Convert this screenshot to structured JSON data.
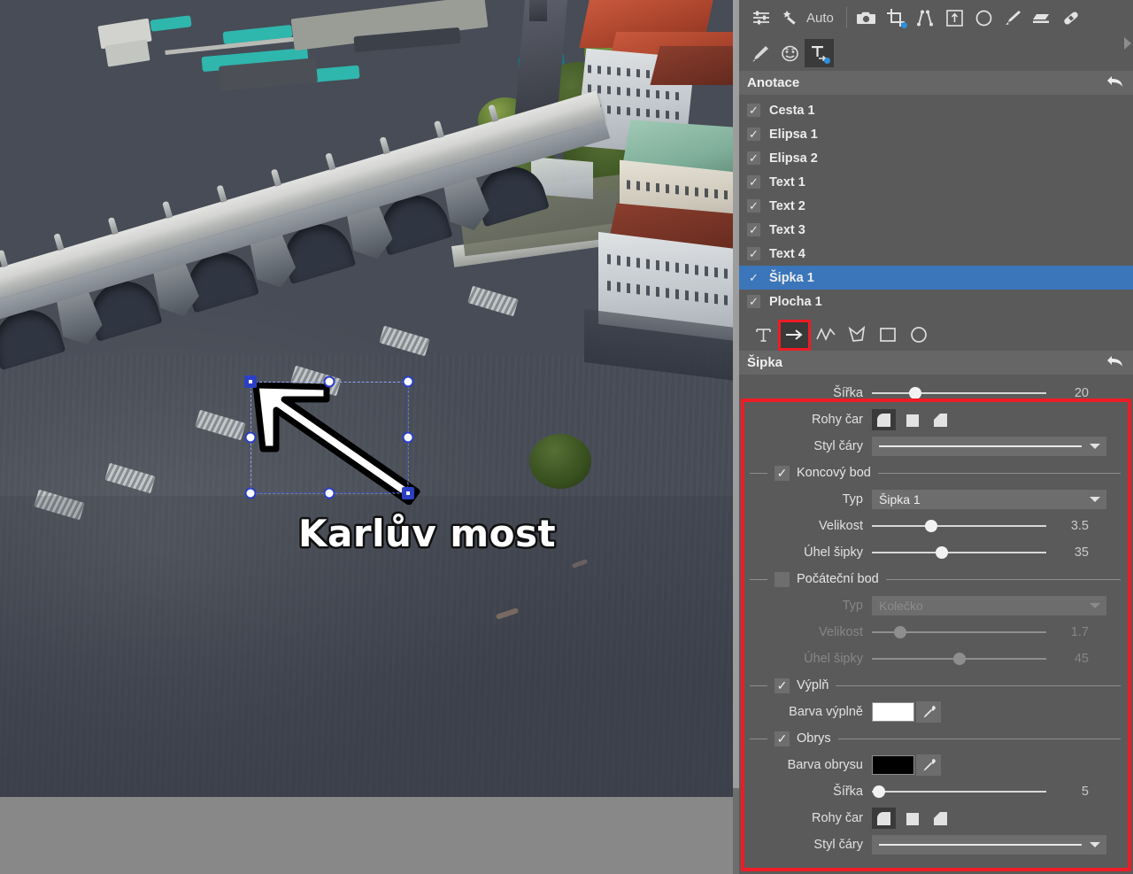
{
  "app": {
    "canvas": {
      "label_text": "Karlův most",
      "scene": "aerial-view-charles-bridge-prague"
    },
    "toolbar": {
      "row1": [
        {
          "name": "adjustments-sliders-icon",
          "label": "",
          "selected": false
        },
        {
          "name": "magic-wand-icon",
          "label": "",
          "selected": false
        },
        {
          "name": "auto-label",
          "label": "Auto",
          "selected": false
        },
        {
          "name": "camera-icon",
          "label": "",
          "selected": false
        },
        {
          "name": "crop-icon",
          "label": "",
          "selected": false,
          "dot": true
        },
        {
          "name": "perspective-icon",
          "label": "",
          "selected": false
        },
        {
          "name": "rotate-frame-icon",
          "label": "",
          "selected": false
        },
        {
          "name": "ellipse-icon",
          "label": "",
          "selected": false
        },
        {
          "name": "brush-icon",
          "label": "",
          "selected": false
        },
        {
          "name": "gradient-icon",
          "label": "",
          "selected": false
        },
        {
          "name": "healing-patch-icon",
          "label": "",
          "selected": false
        }
      ],
      "row2": [
        {
          "name": "clone-stamp-icon",
          "label": "",
          "selected": false
        },
        {
          "name": "face-mask-icon",
          "label": "",
          "selected": false
        },
        {
          "name": "text-annotation-icon",
          "label": "",
          "selected": true,
          "dot": true
        }
      ]
    },
    "annotations_panel": {
      "title": "Anotace",
      "undo_icon": "undo-arrow-icon",
      "items": [
        {
          "label": "Cesta 1",
          "checked": true,
          "selected": false
        },
        {
          "label": "Elipsa 1",
          "checked": true,
          "selected": false
        },
        {
          "label": "Elipsa 2",
          "checked": true,
          "selected": false
        },
        {
          "label": "Text 1",
          "checked": true,
          "selected": false
        },
        {
          "label": "Text 2",
          "checked": true,
          "selected": false
        },
        {
          "label": "Text 3",
          "checked": true,
          "selected": false
        },
        {
          "label": "Text 4",
          "checked": true,
          "selected": false
        },
        {
          "label": "Šipka 1",
          "checked": true,
          "selected": true
        },
        {
          "label": "Plocha 1",
          "checked": true,
          "selected": false
        }
      ],
      "check_glyph": "✓"
    },
    "shape_tools": [
      {
        "name": "text-tool-icon",
        "selected": false,
        "highlighted": false
      },
      {
        "name": "arrow-tool-icon",
        "selected": true,
        "highlighted": true
      },
      {
        "name": "polyline-tool-icon",
        "selected": false,
        "highlighted": false
      },
      {
        "name": "polygon-tool-icon",
        "selected": false,
        "highlighted": false
      },
      {
        "name": "rectangle-tool-icon",
        "selected": false,
        "highlighted": false
      },
      {
        "name": "ellipse-tool-icon",
        "selected": false,
        "highlighted": false
      }
    ],
    "properties": {
      "title": "Šipka",
      "undo_icon": "undo-arrow-icon",
      "width": {
        "label": "Šířka",
        "value": "20",
        "pct": 25
      },
      "line_corners": {
        "label": "Rohy čar",
        "options": [
          "round-corner-icon",
          "square-corner-icon",
          "bevel-corner-icon"
        ],
        "selected_index": 0
      },
      "line_style": {
        "label": "Styl čáry",
        "value": ""
      },
      "end_point": {
        "label": "Koncový bod",
        "checked": true,
        "type": {
          "label": "Typ",
          "value": "Šipka 1"
        },
        "size": {
          "label": "Velikost",
          "value": "3.5",
          "pct": 34
        },
        "arrow_angle": {
          "label": "Úhel šipky",
          "value": "35",
          "pct": 40
        }
      },
      "start_point": {
        "label": "Počáteční bod",
        "checked": false,
        "type": {
          "label": "Typ",
          "value": "Kolečko"
        },
        "size": {
          "label": "Velikost",
          "value": "1.7",
          "pct": 16
        },
        "arrow_angle": {
          "label": "Úhel šipky",
          "value": "45",
          "pct": 50
        }
      },
      "fill": {
        "label": "Výplň",
        "checked": true,
        "color": {
          "label": "Barva výplně",
          "value": "#ffffff",
          "picker": "eyedropper-icon"
        }
      },
      "outline": {
        "label": "Obrys",
        "checked": true,
        "color": {
          "label": "Barva obrysu",
          "value": "#000000",
          "picker": "eyedropper-icon"
        },
        "width": {
          "label": "Šířka",
          "value": "5",
          "pct": 4
        },
        "line_corners": {
          "label": "Rohy čar",
          "options": [
            "round-corner-icon",
            "square-corner-icon",
            "bevel-corner-icon"
          ],
          "selected_index": 0
        },
        "line_style": {
          "label": "Styl čáry",
          "value": ""
        }
      }
    },
    "colors": {
      "panel_bg": "#5a5a5a",
      "header_bg": "#666666",
      "selection_blue": "#3b76bb",
      "highlight_red": "#ee1c25",
      "accent_dot": "#2b8fe0",
      "handle_blue": "#2b3fc4"
    }
  }
}
